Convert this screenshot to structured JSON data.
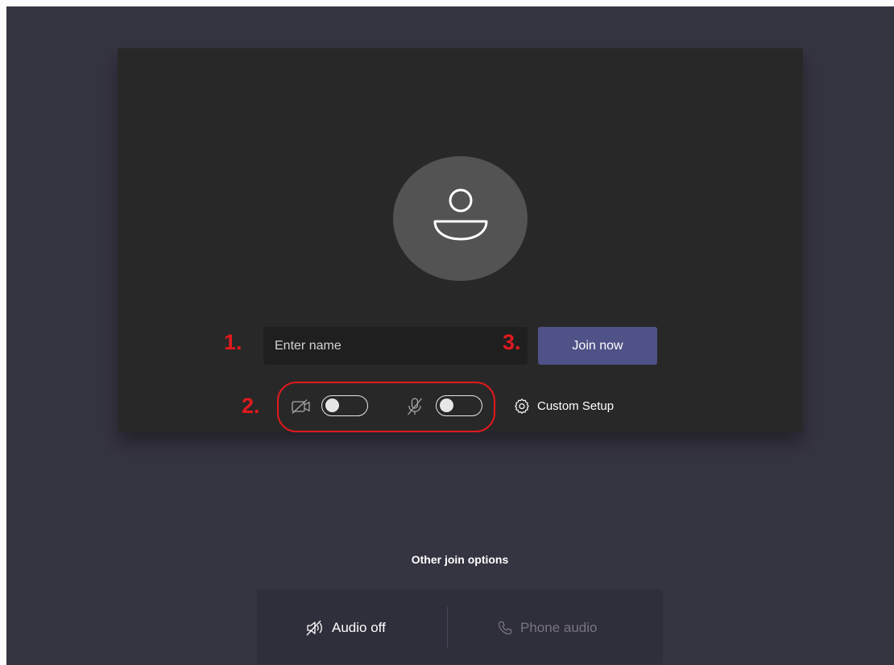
{
  "name_input": {
    "placeholder": "Enter name",
    "value": ""
  },
  "join_button": {
    "label": "Join now"
  },
  "annotations": {
    "step1": "1.",
    "step2": "2.",
    "step3": "3."
  },
  "devices": {
    "camera": {
      "icon": "camera-off-icon",
      "state": "off"
    },
    "microphone": {
      "icon": "mic-off-icon",
      "state": "off"
    }
  },
  "custom_setup": {
    "icon": "gear-icon",
    "label": "Custom Setup"
  },
  "other_join": {
    "title": "Other join options",
    "options": [
      {
        "icon": "speaker-off-icon",
        "label": "Audio off",
        "enabled": true
      },
      {
        "icon": "phone-icon",
        "label": "Phone audio",
        "enabled": false
      }
    ]
  },
  "colors": {
    "page_background": "#353441",
    "card_background": "#282828",
    "avatar_background": "#535353",
    "join_button": "#4f5287",
    "annotation_red": "#e0191d"
  }
}
